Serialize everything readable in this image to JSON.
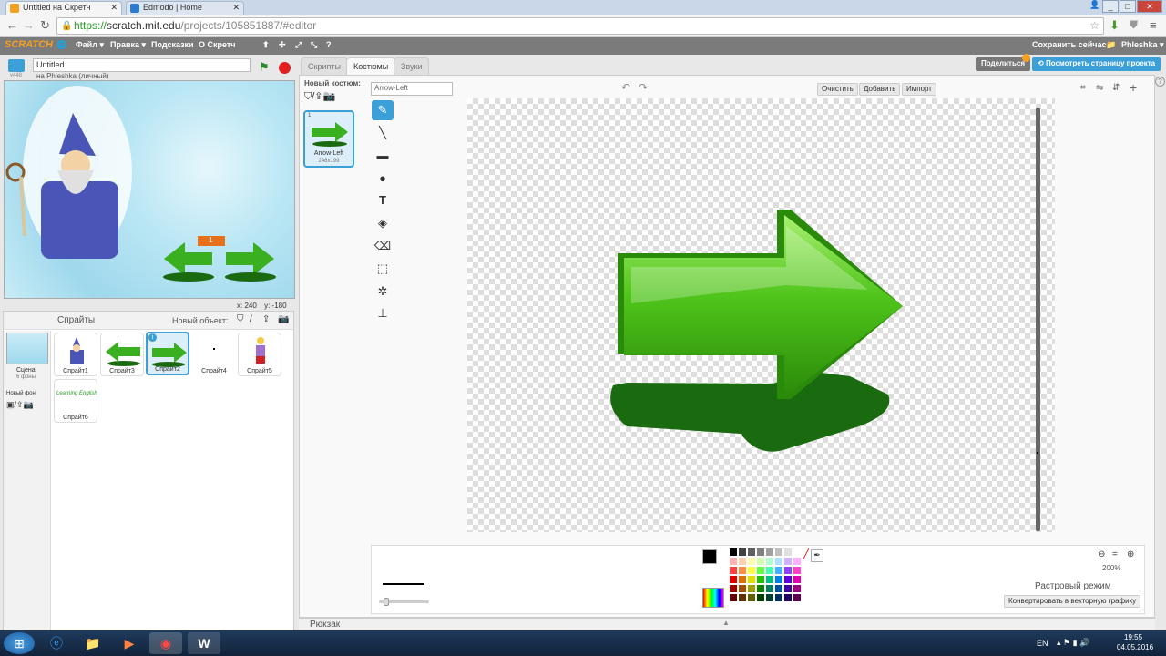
{
  "browser": {
    "tabs": [
      {
        "title": "Untitled на Скретч",
        "active": true
      },
      {
        "title": "Edmodo | Home",
        "active": false
      }
    ],
    "url_prefix": "https://",
    "url_host": "scratch.mit.edu",
    "url_path": "/projects/105851887/#editor",
    "win_buttons": [
      "_",
      "□",
      "✕"
    ]
  },
  "menu": {
    "logo": "SCRATCH",
    "items": [
      "Файл ▾",
      "Правка ▾",
      "Подсказки",
      "О Скретч"
    ],
    "save_now": "Сохранить сейчас",
    "user": "Phleshka ▾"
  },
  "project": {
    "title": "Untitled",
    "owner": "на Phleshka (личный)",
    "version": "v448",
    "share": "Поделиться",
    "see_page": "Посмотреть страницу проекта",
    "coord_x_label": "x:",
    "coord_x": "240",
    "coord_y_label": "y:",
    "coord_y": "-180",
    "stage_counter": "1"
  },
  "sprites_pane": {
    "title": "Спрайты",
    "new_object": "Новый объект:",
    "scene_label": "Сцена",
    "scene_count": "6 фоны",
    "new_bg": "Новый фон:",
    "sprites": [
      {
        "name": "Спрайт1",
        "selected": false
      },
      {
        "name": "Спрайт3",
        "selected": false
      },
      {
        "name": "Спрайт2",
        "selected": true
      },
      {
        "name": "Спрайт4",
        "selected": false
      },
      {
        "name": "Спрайт5",
        "selected": false
      },
      {
        "name": "Спрайт6",
        "selected": false
      }
    ],
    "sprite6_text": "Learning English"
  },
  "editor": {
    "tabs": [
      "Скрипты",
      "Костюмы",
      "Звуки"
    ],
    "active_tab": "Костюмы",
    "new_costume": "Новый костюм:",
    "costume_name": "Arrow-Left",
    "costume_size": "246x199",
    "costume_index": "1",
    "clear": "Очистить",
    "add": "Добавить",
    "import": "Импорт",
    "zoom": "200%",
    "mode": "Растровый режим",
    "convert": "Конвертировать в векторную графику",
    "backpack": "Рюкзак",
    "tools": [
      "brush-icon",
      "line-icon",
      "rectangle-icon",
      "ellipse-icon",
      "text-icon",
      "fill-icon",
      "eraser-icon",
      "select-icon",
      "wand-icon",
      "stamp-icon"
    ],
    "selected_tool": "brush-icon"
  },
  "palette": {
    "row_colors": [
      [
        "#000000",
        "#404040",
        "#606060",
        "#808080",
        "#a0a0a0",
        "#c0c0c0",
        "#e0e0e0",
        "#ffffff"
      ],
      [
        "#ffb0b0",
        "#ffd0b0",
        "#ffffb0",
        "#d0ffb0",
        "#b0ffd0",
        "#b0e0ff",
        "#d0b0ff",
        "#ffb0ff"
      ],
      [
        "#ff4040",
        "#ff9040",
        "#ffff40",
        "#60ff40",
        "#40ffb0",
        "#40b0ff",
        "#9040ff",
        "#ff40d0"
      ],
      [
        "#e00000",
        "#e07000",
        "#e0e000",
        "#20c000",
        "#00c080",
        "#0080e0",
        "#6000e0",
        "#e000b0"
      ],
      [
        "#a00000",
        "#a05000",
        "#a0a000",
        "#108000",
        "#008060",
        "#0050a0",
        "#4000a0",
        "#a00080"
      ],
      [
        "#600000",
        "#603000",
        "#606000",
        "#004000",
        "#004030",
        "#003060",
        "#200060",
        "#600050"
      ]
    ]
  },
  "taskbar": {
    "lang": "EN",
    "time": "19:55",
    "date": "04.05.2016"
  }
}
